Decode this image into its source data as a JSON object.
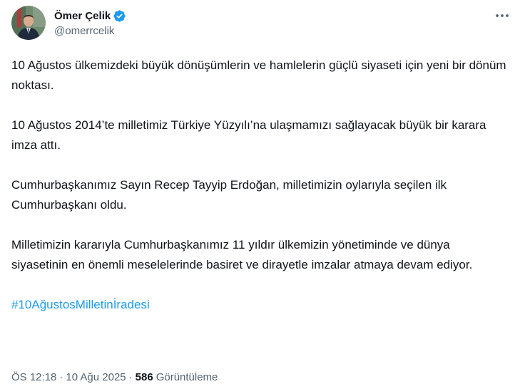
{
  "author": {
    "display_name": "Ömer Çelik",
    "handle": "@omerrcelik"
  },
  "tweet": {
    "paragraphs": [
      "10 Ağustos ülkemizdeki büyük dönüşümlerin ve hamlelerin güçlü siyaseti için yeni bir dönüm noktası.",
      "10 Ağustos 2014’te milletimiz Türkiye Yüzyılı’na ulaşmamızı sağlayacak büyük bir karara imza attı.",
      "Cumhurbaşkanımız Sayın Recep Tayyip Erdoğan, milletimizin  oylarıyla seçilen ilk Cumhurbaşkanı oldu.",
      "Milletimizin kararıyla Cumhurbaşkanımız 11 yıldır ülkemizin yönetiminde ve dünya siyasetinin en önemli meselelerinde basiret ve dirayetle imzalar atmaya devam ediyor."
    ],
    "hashtag": "#10AğustosMilletinİradesi"
  },
  "meta": {
    "time": "ÖS 12:18",
    "separator": "·",
    "date": "10 Ağu 2025",
    "views_count": "586",
    "views_label": "Görüntüleme"
  },
  "icons": {
    "verified": "verified-badge-icon",
    "more": "more-dots-icon"
  },
  "colors": {
    "accent": "#1d9bf0",
    "text": "#0f1419",
    "secondary": "#536471"
  }
}
